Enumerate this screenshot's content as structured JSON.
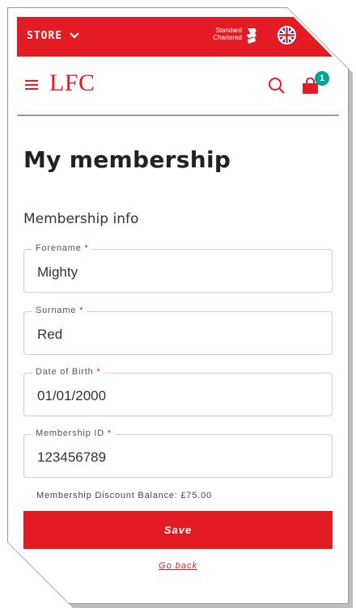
{
  "store_bar": {
    "store_label": "STORE",
    "sponsor_line1": "Standard",
    "sponsor_line2": "Chartered"
  },
  "header": {
    "logo_text": "LFC",
    "cart_count": "1"
  },
  "page": {
    "title": "My membership",
    "section_title": "Membership info"
  },
  "form": {
    "required_marker": "*",
    "fields": [
      {
        "label": "Forename",
        "value": "Mighty"
      },
      {
        "label": "Surname",
        "value": "Red"
      },
      {
        "label": "Date of Birth",
        "value": "01/01/2000"
      },
      {
        "label": "Membership ID",
        "value": "123456789"
      }
    ],
    "discount_balance": "Membership Discount Balance: £75.00",
    "save_label": "Save",
    "go_back_label": "Go back"
  },
  "colors": {
    "brand_red": "#e31b23",
    "badge_teal": "#00a398",
    "text_dark": "#222222"
  },
  "icons": {
    "store_dropdown": "chevron-down-icon",
    "sponsor": "standard-chartered-logo-icon",
    "language": "uk-flag-icon",
    "menu": "menu-icon",
    "search": "search-icon",
    "cart": "shopping-bag-icon"
  }
}
